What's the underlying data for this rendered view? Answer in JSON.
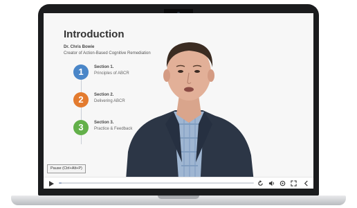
{
  "slide": {
    "title": "Introduction",
    "presenter_name": "Dr. Chris Bowie",
    "presenter_role": "Creator of Action-Based Cognitive Remediation",
    "sections": [
      {
        "number": "1",
        "title": "Section 1.",
        "description": "Principles of ABCR",
        "color": "#4a86c8"
      },
      {
        "number": "2",
        "title": "Section 2.",
        "description": "Delivering ABCR",
        "color": "#e37b2f"
      },
      {
        "number": "3",
        "title": "Section 3.",
        "description": "Practice & Feedback",
        "color": "#63b04a"
      }
    ]
  },
  "player": {
    "tooltip": "Pause (Ctrl+Alt+P)",
    "progress_fraction": 0.015,
    "icons": [
      "play-icon",
      "replay-icon",
      "volume-icon",
      "settings-icon",
      "fullscreen-icon",
      "collapse-icon"
    ]
  }
}
